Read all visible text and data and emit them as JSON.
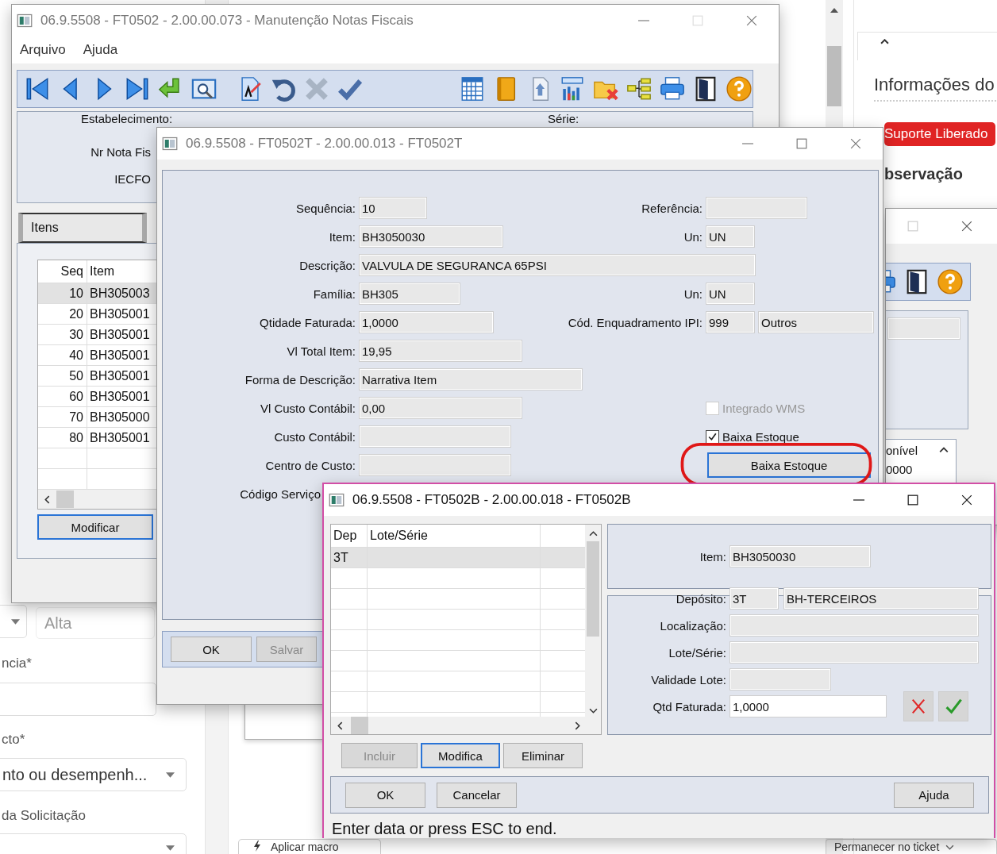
{
  "web_page": {
    "heading": "Informações do",
    "badge": "Suporte Liberado",
    "section": "bservação",
    "priority": "Alta",
    "labels": [
      "ncia*",
      "cto*",
      "da Solicitação"
    ],
    "category": "nto ou desempenh...",
    "macro_button": "Aplicar macro",
    "ticket_option": "Permanecer no ticket"
  },
  "side_window": {
    "column_header": "onível",
    "cell": "0000"
  },
  "main_window": {
    "title": "06.9.5508 - FT0502 - 2.00.00.073 - Manutenção Notas Fiscais",
    "menu": [
      "Arquivo",
      "Ajuda"
    ],
    "header_labels": [
      "Estabelecimento:",
      "Série:",
      "Nr Nota Fis",
      "IECFO"
    ],
    "tabs": [
      {
        "label": "Itens",
        "selected": true
      }
    ],
    "table": {
      "columns": [
        "Seq",
        "Item"
      ],
      "rows": [
        {
          "seq": "10",
          "item": "BH305003",
          "selected": true
        },
        {
          "seq": "20",
          "item": "BH305001",
          "selected": false
        },
        {
          "seq": "30",
          "item": "BH305001",
          "selected": false
        },
        {
          "seq": "40",
          "item": "BH305001",
          "selected": false
        },
        {
          "seq": "50",
          "item": "BH305001",
          "selected": false
        },
        {
          "seq": "60",
          "item": "BH305001",
          "selected": false
        },
        {
          "seq": "70",
          "item": "BH305000",
          "selected": false
        },
        {
          "seq": "80",
          "item": "BH305001",
          "selected": false
        }
      ]
    },
    "button": {
      "label": "Modificar",
      "focused": true
    }
  },
  "item_window": {
    "title": "06.9.5508 - FT0502T - 2.00.00.013 - FT0502T",
    "rows": [
      {
        "label": "Sequência:",
        "kind": "field",
        "value": "10",
        "right": {
          "kind": "field",
          "label": "Referência:"
        }
      },
      {
        "label": "Item:",
        "kind": "field",
        "value": "BH3050030",
        "right": {
          "kind": "field",
          "label": "Un:",
          "value": "UN"
        }
      },
      {
        "label": "Descrição:",
        "kind": "field",
        "value": "VALVULA DE SEGURANCA 65PSI"
      },
      {
        "label": "Família:",
        "kind": "field",
        "value": "BH305",
        "right": {
          "kind": "field",
          "label": "Un:",
          "value": "UN"
        }
      },
      {
        "label": "Qtidade Faturada:",
        "kind": "field",
        "value": "1,0000",
        "right": {
          "kind": "field",
          "label": "Cód. Enquadramento IPI:",
          "value": "999",
          "value_2": "Outros"
        }
      },
      {
        "label": "Vl Total Item:",
        "kind": "field",
        "value": "19,95"
      },
      {
        "label": "Forma de Descrição:",
        "kind": "field",
        "value": "Narrativa Item"
      },
      {
        "label": "Vl Custo Contábil:",
        "kind": "field",
        "value": "0,00",
        "right": {
          "kind": "checkbox",
          "label": "Integrado WMS",
          "checked": false,
          "disabled": true
        }
      },
      {
        "label": "Custo Contábil:",
        "kind": "field",
        "right": {
          "kind": "checkbox",
          "label": "Baixa Estoque",
          "checked": true,
          "disabled": false
        }
      },
      {
        "label": "Centro de Custo:",
        "kind": "field",
        "right": {
          "kind": "button",
          "label": "Baixa Estoque",
          "focused": true,
          "highlighted": true
        }
      },
      {
        "label": "Código Serviço",
        "kind": "label"
      }
    ],
    "buttons": [
      {
        "label": "OK",
        "disabled": false
      },
      {
        "label": "Salvar",
        "disabled": true
      }
    ]
  },
  "lot_window": {
    "title": "06.9.5508 - FT0502B - 2.00.00.018 - FT0502B",
    "table": {
      "columns": [
        "Dep",
        "Lote/Série"
      ],
      "rows": [
        {
          "dep": "3T",
          "selected": true
        }
      ]
    },
    "item": {
      "label": "Item:",
      "value": "BH3050030"
    },
    "fields": [
      {
        "label": "Depósito:",
        "value": "3T",
        "value_2": "BH-TERCEIROS"
      },
      {
        "label": "Localização:"
      },
      {
        "label": "Lote/Série:"
      },
      {
        "label": "Validade Lote:"
      },
      {
        "label": "Qtd Faturada:",
        "value": "1,0000"
      }
    ],
    "row_buttons": [
      {
        "label": "Incluir",
        "disabled": true,
        "focused": false
      },
      {
        "label": "Modifica",
        "disabled": false,
        "focused": true
      },
      {
        "label": "Eliminar",
        "disabled": false,
        "focused": false
      }
    ],
    "buttons": [
      "OK",
      "Cancelar"
    ],
    "help_button": "Ajuda",
    "status": "Enter data or press ESC to end."
  }
}
